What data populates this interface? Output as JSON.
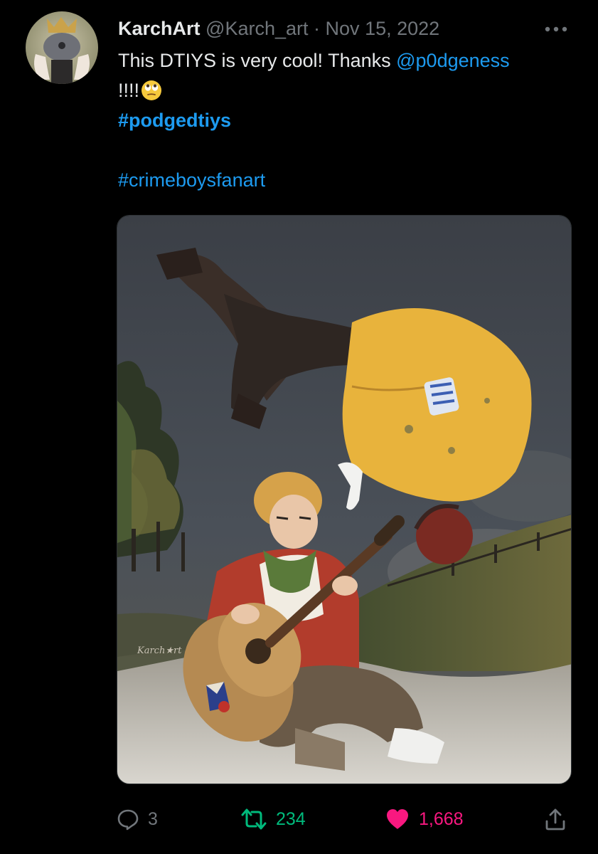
{
  "tweet": {
    "author": {
      "name": "KarchArt",
      "handle": "@Karch_art"
    },
    "separator": "·",
    "date": "Nov 15, 2022",
    "text": {
      "line1_prefix": "This DTIYS is very cool! Thanks ",
      "mention": "@p0dgeness",
      "line2": "!!!!",
      "emoji": "face-with-rolling-eyes",
      "hashtag1": "#podgedtiys",
      "hashtag2": "#crimeboysfanart"
    },
    "media": {
      "type": "illustration",
      "signature": "Karch★rt"
    },
    "actions": {
      "replies": "3",
      "retweets": "234",
      "likes": "1,668"
    }
  },
  "icons": {
    "more": "more-options-icon",
    "reply": "reply-icon",
    "retweet": "retweet-icon",
    "like": "heart-icon",
    "share": "share-icon"
  },
  "colors": {
    "background": "#000000",
    "link": "#1d9bf0",
    "muted": "#71767b",
    "retweet": "#00ba7c",
    "like": "#f91880"
  }
}
